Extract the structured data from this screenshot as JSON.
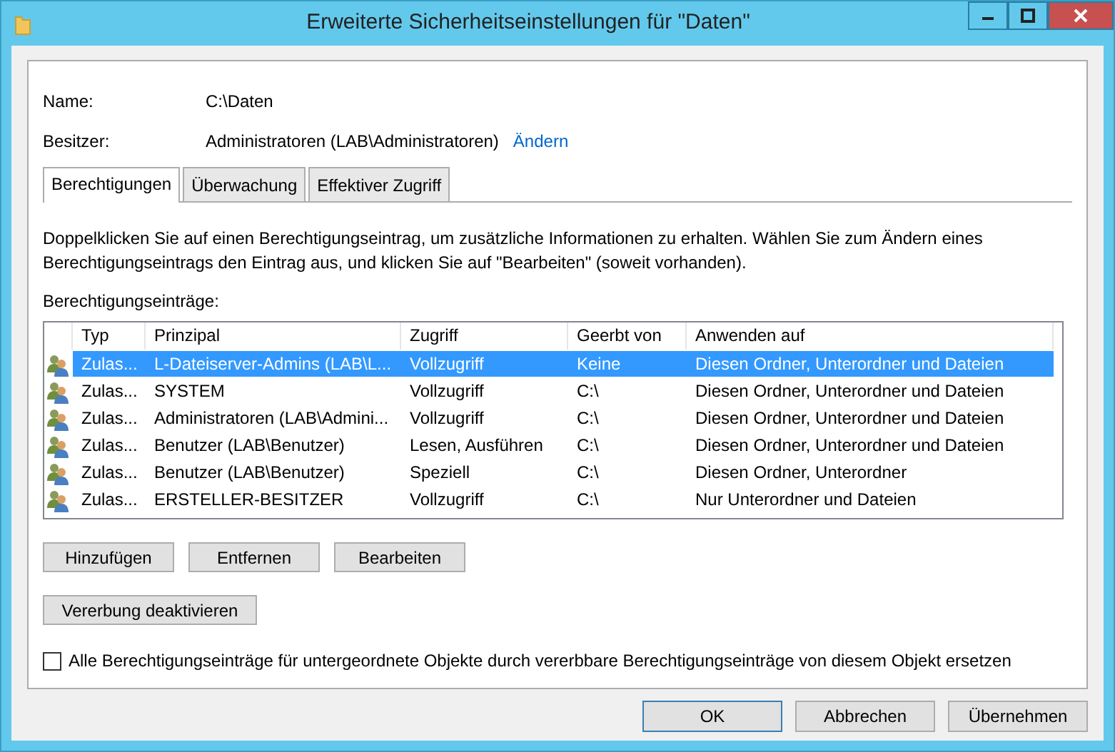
{
  "window": {
    "title": "Erweiterte Sicherheitseinstellungen für \"Daten\""
  },
  "fields": [
    {
      "label": "Name:",
      "value": "C:\\Daten"
    },
    {
      "label": "Besitzer:",
      "value": "Administratoren (LAB\\Administratoren)",
      "link": "Ändern"
    }
  ],
  "tabs": [
    {
      "label": "Berechtigungen",
      "selected": true
    },
    {
      "label": "Überwachung",
      "selected": false
    },
    {
      "label": "Effektiver Zugriff",
      "selected": false
    }
  ],
  "description": "Doppelklicken Sie auf einen Berechtigungseintrag, um zusätzliche Informationen zu erhalten. Wählen Sie zum Ändern eines Berechtigungseintrags den Eintrag aus, und klicken Sie auf \"Bearbeiten\" (soweit vorhanden).",
  "list_label": "Berechtigungseinträge:",
  "table": {
    "columns": [
      "Typ",
      "Prinzipal",
      "Zugriff",
      "Geerbt von",
      "Anwenden auf"
    ],
    "rows": [
      {
        "cells": [
          "Zulas...",
          "L-Dateiserver-Admins (LAB\\L...",
          "Vollzugriff",
          "Keine",
          "Diesen Ordner, Unterordner und Dateien"
        ],
        "selected": true
      },
      {
        "cells": [
          "Zulas...",
          "SYSTEM",
          "Vollzugriff",
          "C:\\",
          "Diesen Ordner, Unterordner und Dateien"
        ],
        "selected": false
      },
      {
        "cells": [
          "Zulas...",
          "Administratoren (LAB\\Admini...",
          "Vollzugriff",
          "C:\\",
          "Diesen Ordner, Unterordner und Dateien"
        ],
        "selected": false
      },
      {
        "cells": [
          "Zulas...",
          "Benutzer (LAB\\Benutzer)",
          "Lesen, Ausführen",
          "C:\\",
          "Diesen Ordner, Unterordner und Dateien"
        ],
        "selected": false
      },
      {
        "cells": [
          "Zulas...",
          "Benutzer (LAB\\Benutzer)",
          "Speziell",
          "C:\\",
          "Diesen Ordner, Unterordner"
        ],
        "selected": false
      },
      {
        "cells": [
          "Zulas...",
          "ERSTELLER-BESITZER",
          "Vollzugriff",
          "C:\\",
          "Nur Unterordner und Dateien"
        ],
        "selected": false
      }
    ]
  },
  "entry_buttons": [
    "Hinzufügen",
    "Entfernen",
    "Bearbeiten"
  ],
  "inheritance_button": "Vererbung deaktivieren",
  "replace_checkbox": {
    "label": "Alle Berechtigungseinträge für untergeordnete Objekte durch vererbbare Berechtigungseinträge von diesem Objekt ersetzen",
    "checked": false
  },
  "dialog_buttons": [
    {
      "label": "OK",
      "default": true
    },
    {
      "label": "Abbrechen",
      "default": false
    },
    {
      "label": "Übernehmen",
      "default": false
    }
  ]
}
